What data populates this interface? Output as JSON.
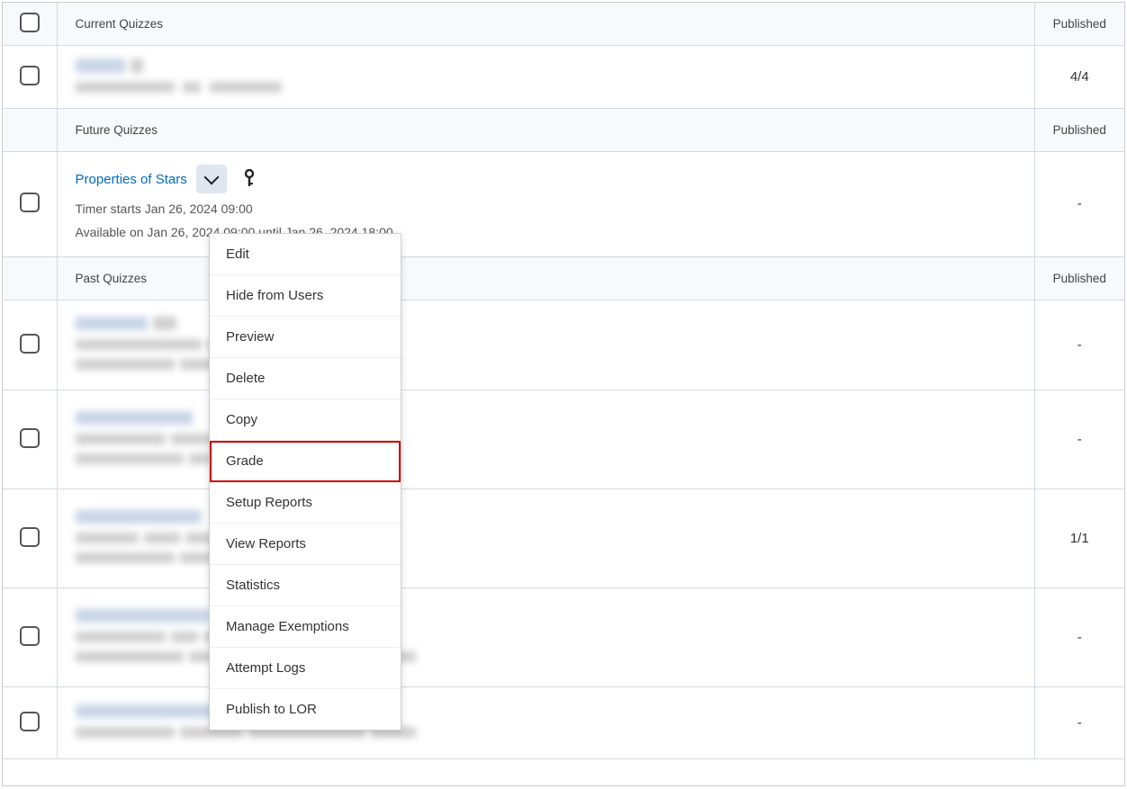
{
  "sections": {
    "current": {
      "label": "Current Quizzes",
      "published_header": "Published"
    },
    "future": {
      "label": "Future Quizzes",
      "published_header": "Published"
    },
    "past": {
      "label": "Past Quizzes",
      "published_header": "Published"
    }
  },
  "current_quiz": {
    "published": "4/4"
  },
  "future_quiz": {
    "title": "Properties of Stars",
    "timer_line": "Timer starts Jan 26, 2024 09:00",
    "avail_line": "Available on Jan 26, 2024 09:00 until Jan 26, 2024 18:00",
    "published": "-"
  },
  "past_quizzes": [
    {
      "published": "-"
    },
    {
      "published": "-"
    },
    {
      "published": "1/1"
    },
    {
      "published": "-"
    },
    {
      "published": "-"
    }
  ],
  "menu": {
    "items": [
      "Edit",
      "Hide from Users",
      "Preview",
      "Delete",
      "Copy",
      "Grade",
      "Setup Reports",
      "View Reports",
      "Statistics",
      "Manage Exemptions",
      "Attempt Logs",
      "Publish to LOR"
    ],
    "highlight_index": 5
  }
}
